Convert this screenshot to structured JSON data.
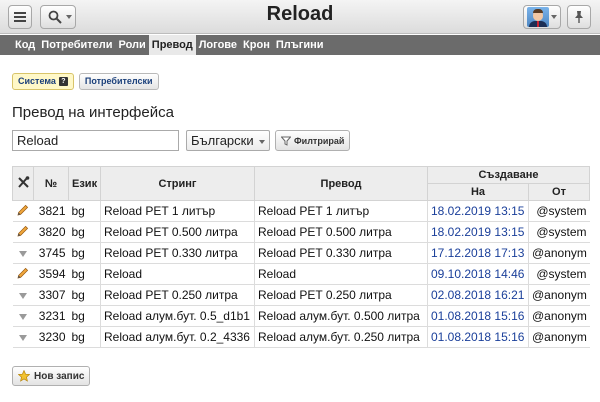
{
  "header": {
    "title": "Reload"
  },
  "nav": {
    "tabs": [
      "Код",
      "Потребители",
      "Роли",
      "Превод",
      "Логове",
      "Крон",
      "Плъгини"
    ],
    "active": 3
  },
  "subtabs": [
    "Система",
    "Потребителски"
  ],
  "page_title": "Превод на интерфейса",
  "filter": {
    "search_value": "Reload",
    "language": "Български",
    "button": "Филтрирай"
  },
  "table": {
    "headers": {
      "num": "№",
      "lang": "Език",
      "string": "Стринг",
      "translation": "Превод",
      "created": "Създаване",
      "on": "На",
      "from": "От"
    },
    "rows": [
      {
        "icon": "pencil-icon",
        "num": "3821",
        "lang": "bg",
        "string": "Reload PET 1 литър",
        "translation": "Reload PET 1 литър",
        "date": "18.02.2019 13:15",
        "from": "@system"
      },
      {
        "icon": "pencil-icon",
        "num": "3820",
        "lang": "bg",
        "string": "Reload PET 0.500 литра",
        "translation": "Reload PET 0.500 литра",
        "date": "18.02.2019 13:15",
        "from": "@system"
      },
      {
        "icon": "triangle-down-icon",
        "num": "3745",
        "lang": "bg",
        "string": "Reload PET 0.330 литра",
        "translation": "Reload PET 0.330 литра",
        "date": "17.12.2018 17:13",
        "from": "@anonym"
      },
      {
        "icon": "pencil-icon",
        "num": "3594",
        "lang": "bg",
        "string": "Reload",
        "translation": "Reload",
        "date": "09.10.2018 14:46",
        "from": "@system"
      },
      {
        "icon": "triangle-down-icon",
        "num": "3307",
        "lang": "bg",
        "string": "Reload PET 0.250 литра",
        "translation": "Reload PET 0.250 литра",
        "date": "02.08.2018 16:21",
        "from": "@anonym"
      },
      {
        "icon": "triangle-down-icon",
        "num": "3231",
        "lang": "bg",
        "string": "Reload алум.бут. 0.5_d1b1",
        "translation": "Reload алум.бут. 0.500 литра",
        "date": "01.08.2018 15:16",
        "from": "@anonym"
      },
      {
        "icon": "triangle-down-icon",
        "num": "3230",
        "lang": "bg",
        "string": "Reload алум.бут. 0.2_4336",
        "translation": "Reload алум.бут. 0.250 литра",
        "date": "01.08.2018 15:16",
        "from": "@anonym"
      }
    ]
  },
  "new_button": "Нов запис",
  "colors": {
    "nav_bg": "#6b6b6b",
    "date_text": "#1a3f9a",
    "active_subtab": "#fff8c8"
  }
}
